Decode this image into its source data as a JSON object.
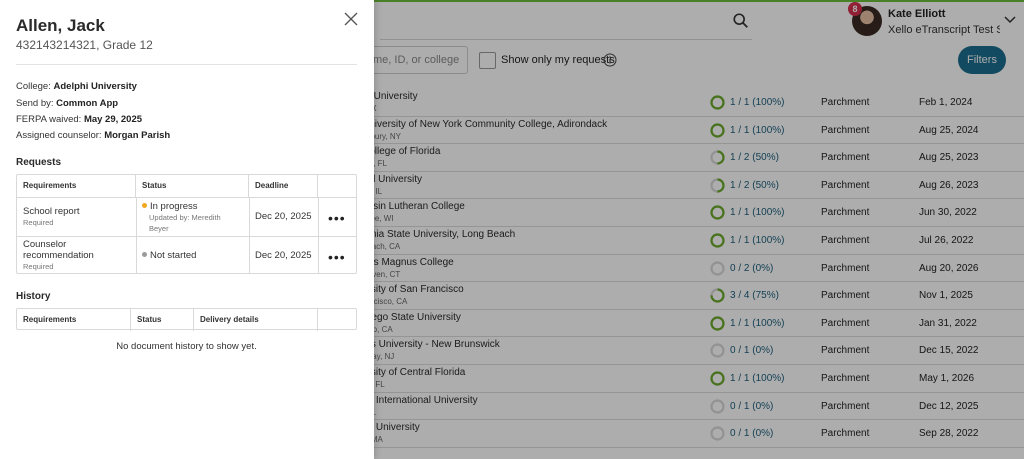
{
  "header": {
    "user_name": "Kate Elliott",
    "user_org": "Xello eTranscript Test S...",
    "notification_count": "8",
    "search_icon": "search-icon"
  },
  "filters": {
    "search_placeholder": "me, ID, or college",
    "show_only_mine_label": "Show only my requests",
    "filters_button": "Filters"
  },
  "colors": {
    "accent": "#1b6e8f",
    "complete": "#6aaa2a",
    "in_progress": "#f2a71e",
    "not_started": "#9b9b9b",
    "top_line": "#6cbf3b"
  },
  "rows": [
    {
      "college": "or University",
      "location": ", TX",
      "progress": "1 / 1 (100%)",
      "fraction": 1,
      "provider": "Parchment",
      "date": "Feb 1, 2024"
    },
    {
      "college": "University of New York Community College, Adirondack",
      "location": "nsbury, NY",
      "progress": "1 / 1 (100%)",
      "fraction": 1,
      "provider": "Parchment",
      "date": "Aug 25, 2024"
    },
    {
      "college": "College of Florida",
      "location": "ota, FL",
      "progress": "1 / 2 (50%)",
      "fraction": 0.5,
      "provider": "Parchment",
      "date": "Aug 25, 2023"
    },
    {
      "college": "aul University",
      "location": "go, IL",
      "progress": "1 / 2 (50%)",
      "fraction": 0.5,
      "provider": "Parchment",
      "date": "Aug 26, 2023"
    },
    {
      "college": "onsin Lutheran College",
      "location": "ukee, WI",
      "progress": "1 / 1 (100%)",
      "fraction": 1,
      "provider": "Parchment",
      "date": "Jun 30, 2022"
    },
    {
      "college": "ornia State University, Long Beach",
      "location": "Beach, CA",
      "progress": "1 / 1 (100%)",
      "fraction": 1,
      "provider": "Parchment",
      "date": "Jul 26, 2022"
    },
    {
      "college": "rtus Magnus College",
      "location": "Haven, CT",
      "progress": "0 / 2 (0%)",
      "fraction": 0,
      "provider": "Parchment",
      "date": "Aug 20, 2026"
    },
    {
      "college": "ersity of San Francisco",
      "location": "rancisco, CA",
      "progress": "3 / 4 (75%)",
      "fraction": 0.75,
      "provider": "Parchment",
      "date": "Nov 1, 2025"
    },
    {
      "college": "Diego State University",
      "location": "iego, CA",
      "progress": "1 / 1 (100%)",
      "fraction": 1,
      "provider": "Parchment",
      "date": "Jan 31, 2022"
    },
    {
      "college": "ers University - New Brunswick",
      "location": "away, NJ",
      "progress": "0 / 1 (0%)",
      "fraction": 0,
      "provider": "Parchment",
      "date": "Dec 15, 2022"
    },
    {
      "college": "ersity of Central Florida",
      "location": "do, FL",
      "progress": "1 / 1 (100%)",
      "fraction": 1,
      "provider": "Parchment",
      "date": "May 1, 2026"
    },
    {
      "college": "da International University",
      "location": ", FL",
      "progress": "0 / 1 (0%)",
      "fraction": 0,
      "provider": "Parchment",
      "date": "Dec 12, 2025"
    },
    {
      "college": "on University",
      "location": "n, MA",
      "progress": "0 / 1 (0%)",
      "fraction": 0,
      "provider": "Parchment",
      "date": "Sep 28, 2022"
    }
  ],
  "panel": {
    "student_name": "Allen, Jack",
    "student_sub": "432143214321, Grade 12",
    "close_icon": "close-icon",
    "college_label": "College:",
    "college_value": "Adelphi University",
    "send_label": "Send by:",
    "send_value": "Common App",
    "ferpa_label": "FERPA waived:",
    "ferpa_value": "May 29, 2025",
    "counselor_label": "Assigned counselor:",
    "counselor_value": "Morgan Parish",
    "requests_title": "Requests",
    "requests_headers": [
      "Requirements",
      "Status",
      "Deadline"
    ],
    "requests": [
      {
        "name": "School report",
        "note": "Required",
        "status": "In progress",
        "updated": "Updated by: Meredith Beyer",
        "deadline": "Dec 20, 2025",
        "more": "•••"
      },
      {
        "name": "Counselor recommendation",
        "note": "Required",
        "status": "Not started",
        "updated": "",
        "deadline": "Dec 20, 2025",
        "more": "•••"
      }
    ],
    "history_title": "History",
    "history_headers": [
      "Requirements",
      "Status",
      "Delivery details"
    ],
    "history_empty": "No document history to show yet."
  }
}
